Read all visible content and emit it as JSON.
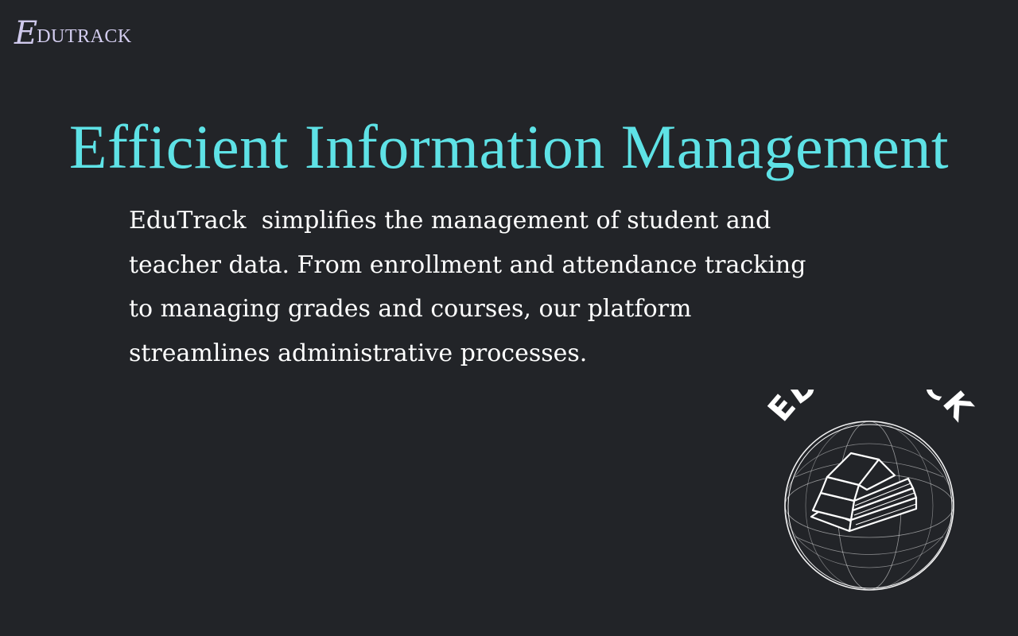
{
  "brand": {
    "initial": "E",
    "rest": "DUTRACK"
  },
  "headline": "Efficient Information Management",
  "body_lines": [
    "EduTrack  simplifies the management of student and",
    "teacher data. From enrollment and attendance tracking",
    "to managing grades and courses, our platform",
    "streamlines administrative processes."
  ],
  "stamp": {
    "arc_text": "EDUTRACK",
    "icon": "open-book-icon"
  },
  "colors": {
    "background": "#222428",
    "headline": "#5ee2e6",
    "body": "#ffffff",
    "brand": "#cfc9ec"
  }
}
